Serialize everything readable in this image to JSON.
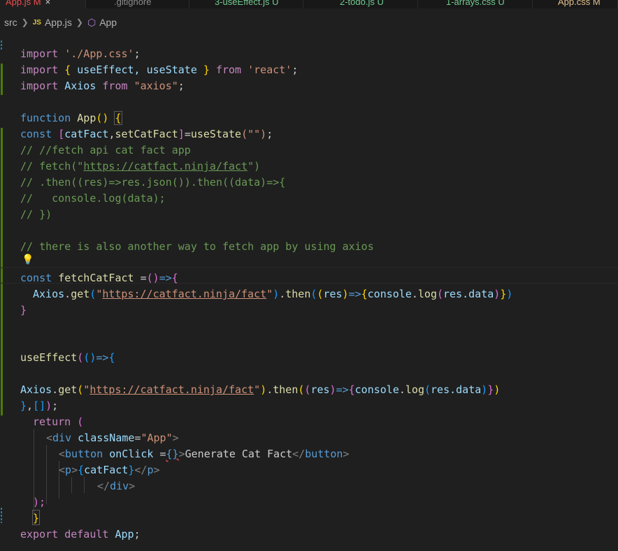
{
  "tabs": [
    {
      "label": "App.js",
      "status": "M",
      "close": "×"
    },
    {
      "label": ".gitignore"
    },
    {
      "label": "3-useEffect.js",
      "status": "U"
    },
    {
      "label": "2-todo.js",
      "status": "U"
    },
    {
      "label": "1-arrays.css",
      "status": "U"
    },
    {
      "label": "App.css",
      "status": "M"
    }
  ],
  "breadcrumb": {
    "folder": "src",
    "js_badge": "JS",
    "file": "App.js",
    "symbol": "App"
  },
  "code": {
    "import_css": {
      "kw": "import",
      "str": "'./App.css'",
      "semi": ";"
    },
    "import_react": {
      "kw": "import",
      "b_open": "{",
      "names": " useEffect, useState ",
      "b_close": "}",
      "from": "from",
      "str": "'react'",
      "semi": ";"
    },
    "import_axios": {
      "kw": "import",
      "name": "Axios",
      "from": "from",
      "str": "\"axios\"",
      "semi": ";"
    },
    "func_decl": {
      "kw": "function",
      "name": "App",
      "parens": "()",
      "brace": "{"
    },
    "use_state": {
      "kw": "const",
      "b_open": "[",
      "a": "catFact",
      "comma": ",",
      "b": "setCatFact",
      "b_close": "]",
      "eq": "=",
      "fn": "useState",
      "arg": "(\"\")",
      "semi": ";"
    },
    "comments": [
      "// //fetch api cat fact app",
      "// fetch(\"",
      "// .then((res)=>res.json()).then((data)=>{",
      "//   console.log(data);",
      "// })"
    ],
    "comment_url": "https://catfact.ninja/fact",
    "comment_url_tail": "\")",
    "comment_axios": "// there is also another way to fetch app by using axios",
    "bulb_icon": "💡",
    "fetch_decl": {
      "kw": "const",
      "name": "fetchCatFact",
      "eq": " =",
      "paren": "()",
      "arrow": "=>",
      "brace": "{"
    },
    "axios_get": {
      "obj": "Axios",
      "dot": ".",
      "method": "get",
      "paren_open": "(",
      "quote_open": "\"",
      "url": "https://catfact.ninja/fact",
      "quote_close": "\"",
      "paren_close": ")",
      "then": "then",
      "res": "res",
      "arrow": "=>",
      "console": "console",
      "log": "log",
      "arg": "res.data"
    },
    "close_brace": "}",
    "use_effect": {
      "fn": "useEffect",
      "paren": "(",
      "inner": "()",
      "arrow": "=>",
      "brace": "{"
    },
    "effect_end": {
      "brace": "}",
      "comma": ",",
      "arr": "[]",
      "paren": ")",
      "semi": ";"
    },
    "return_kw": "return",
    "return_paren": "(",
    "div_open": {
      "lt": "<",
      "tag": "div",
      "attr": "className",
      "eq": "=",
      "val": "\"App\"",
      "gt": ">"
    },
    "button_line": {
      "lt": "<",
      "tag": "button",
      "attr": "onClick",
      "eq": " =",
      "expr": "{}",
      "gt": ">",
      "text": "Generate Cat Fact",
      "close_lt": "</",
      "close_tag": "button",
      "close_gt": ">"
    },
    "p_line": {
      "lt": "<",
      "tag": "p",
      "gt": ">",
      "b_open": "{",
      "var": "catFact",
      "b_close": "}",
      "close_lt": "</",
      "close_tag": "p",
      "close_gt": ">"
    },
    "div_close": {
      "lt": "</",
      "tag": "div",
      "gt": ">"
    },
    "return_close": ");",
    "func_close": "}",
    "export_line": {
      "kw1": "export",
      "kw2": "default",
      "name": "App",
      "semi": ";"
    }
  }
}
